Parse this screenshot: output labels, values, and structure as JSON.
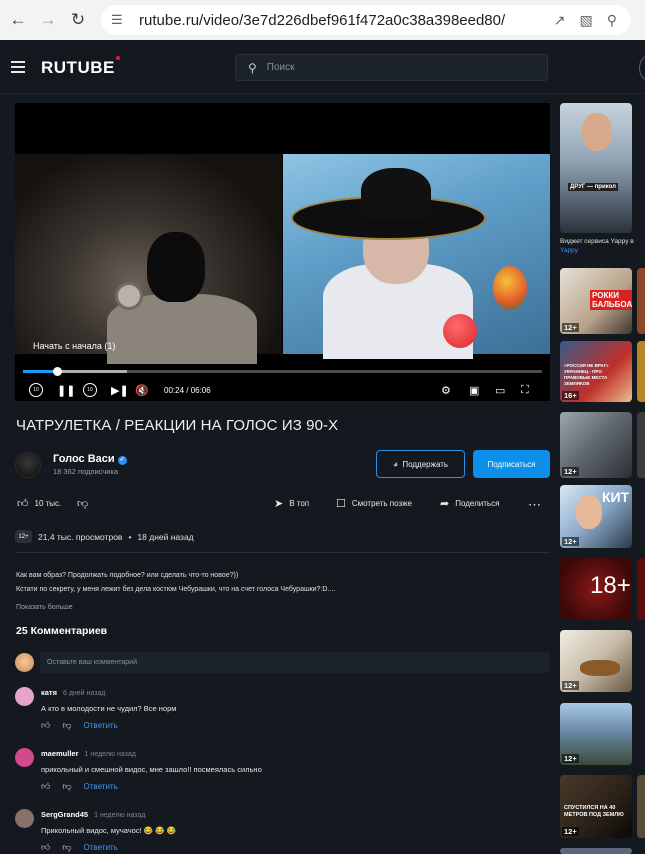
{
  "browser": {
    "url": "rutube.ru/video/3e7d226dbef961f472a0c38a398eed80/"
  },
  "header": {
    "logo": "RUTUBE",
    "search_placeholder": "Поиск"
  },
  "player": {
    "restart_tooltip": "Начать с начала (1)",
    "current_time": "00:24",
    "duration": "06:06",
    "time_display": "00:24 / 06:06",
    "progress_fraction": 0.066,
    "buffered_fraction": 0.2,
    "skip_seconds": "10"
  },
  "video": {
    "title": "ЧАТРУЛЕТКА / РЕАКЦИИ НА ГОЛОС ИЗ 90-Х",
    "channel_name": "Голос Васи",
    "subscribers": "18 362 подписчика",
    "support_label": "Поддержать",
    "subscribe_label": "Подписаться",
    "likes": "10 тыс.",
    "to_top_label": "В топ",
    "watch_later_label": "Смотреть позже",
    "share_label": "Поделиться",
    "age_rating": "12+",
    "views": "21,4 тыс. просмотров",
    "published": "18 дней назад",
    "description_line1": "Как вам образ? Продолжать подобное? или сделать что-то новое?))",
    "description_line2": "Кстати по секрету, у меня лежит без дела костюм Чебурашки, что на счет голоса Чебурашки?:D....",
    "show_more": "Показать больше",
    "comments_heading": "25 Комментариев",
    "comment_placeholder": "Оставьте ваш комментарий"
  },
  "comments": [
    {
      "author": "катя",
      "when": "6 дней назад",
      "text": "А кто в молодости не чудил? Все норм",
      "reply_label": "Ответить",
      "avatar_color": "#e6a4c9"
    },
    {
      "author": "maemuller",
      "when": "1 неделю назад",
      "text": "прикольный и смешной видос, мне зашло!! посмеялась сильно",
      "reply_label": "Ответить",
      "avatar_color": "#d14a8b"
    },
    {
      "author": "SergGrand45",
      "when": "1 неделю назад",
      "text": "Прикольный видос, мучачос! 😂 😂 😂",
      "reply_label": "Ответить",
      "avatar_color": "#8a6f6a"
    }
  ],
  "recommendations": [
    {
      "caption": "Виджет сервиса Yappy в",
      "sponsor": "Yappy",
      "thumb_text": "ДРУГ — прикол",
      "badge": ""
    },
    {
      "thumb_text": "РОККИ БАЛЬБОА",
      "badge": "12+"
    },
    {
      "thumb_text": "«РОССИЯ НЕ ВРАГ» УКРАИНЕЦ - ПРО ПРАВОВЫЕ МЕСТА ЗЕМЛЯКОВ",
      "badge": "16+"
    },
    {
      "thumb_text": "",
      "badge": "12+"
    },
    {
      "thumb_text": "КИТ",
      "badge": "12+"
    },
    {
      "thumb_text": "18+",
      "badge": ""
    },
    {
      "thumb_text": "",
      "badge": "12+"
    },
    {
      "thumb_text": "",
      "badge": "12+"
    },
    {
      "thumb_text": "СПУСТИЛСЯ НА 40 МЕТРОВ ПОД ЗЕМЛЮ",
      "badge": "12+"
    }
  ]
}
